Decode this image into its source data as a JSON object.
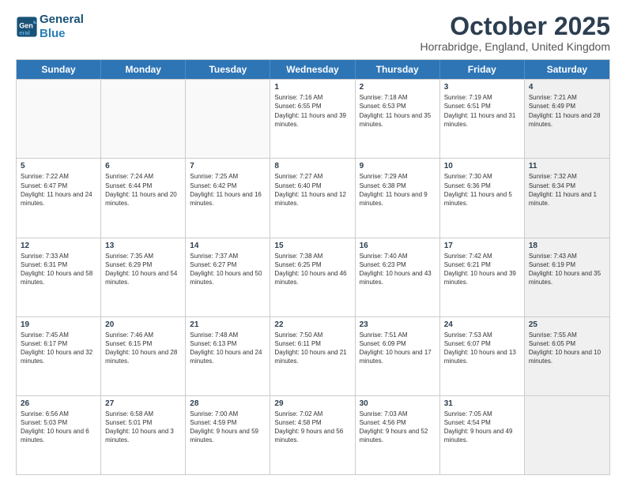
{
  "header": {
    "logo_line1": "General",
    "logo_line2": "Blue",
    "month": "October 2025",
    "location": "Horrabridge, England, United Kingdom"
  },
  "days_of_week": [
    "Sunday",
    "Monday",
    "Tuesday",
    "Wednesday",
    "Thursday",
    "Friday",
    "Saturday"
  ],
  "weeks": [
    [
      {
        "day": "",
        "text": "",
        "empty": true
      },
      {
        "day": "",
        "text": "",
        "empty": true
      },
      {
        "day": "",
        "text": "",
        "empty": true
      },
      {
        "day": "1",
        "text": "Sunrise: 7:16 AM\nSunset: 6:55 PM\nDaylight: 11 hours and 39 minutes."
      },
      {
        "day": "2",
        "text": "Sunrise: 7:18 AM\nSunset: 6:53 PM\nDaylight: 11 hours and 35 minutes."
      },
      {
        "day": "3",
        "text": "Sunrise: 7:19 AM\nSunset: 6:51 PM\nDaylight: 11 hours and 31 minutes."
      },
      {
        "day": "4",
        "text": "Sunrise: 7:21 AM\nSunset: 6:49 PM\nDaylight: 11 hours and 28 minutes.",
        "shaded": true
      }
    ],
    [
      {
        "day": "5",
        "text": "Sunrise: 7:22 AM\nSunset: 6:47 PM\nDaylight: 11 hours and 24 minutes."
      },
      {
        "day": "6",
        "text": "Sunrise: 7:24 AM\nSunset: 6:44 PM\nDaylight: 11 hours and 20 minutes."
      },
      {
        "day": "7",
        "text": "Sunrise: 7:25 AM\nSunset: 6:42 PM\nDaylight: 11 hours and 16 minutes."
      },
      {
        "day": "8",
        "text": "Sunrise: 7:27 AM\nSunset: 6:40 PM\nDaylight: 11 hours and 12 minutes."
      },
      {
        "day": "9",
        "text": "Sunrise: 7:29 AM\nSunset: 6:38 PM\nDaylight: 11 hours and 9 minutes."
      },
      {
        "day": "10",
        "text": "Sunrise: 7:30 AM\nSunset: 6:36 PM\nDaylight: 11 hours and 5 minutes."
      },
      {
        "day": "11",
        "text": "Sunrise: 7:32 AM\nSunset: 6:34 PM\nDaylight: 11 hours and 1 minute.",
        "shaded": true
      }
    ],
    [
      {
        "day": "12",
        "text": "Sunrise: 7:33 AM\nSunset: 6:31 PM\nDaylight: 10 hours and 58 minutes."
      },
      {
        "day": "13",
        "text": "Sunrise: 7:35 AM\nSunset: 6:29 PM\nDaylight: 10 hours and 54 minutes."
      },
      {
        "day": "14",
        "text": "Sunrise: 7:37 AM\nSunset: 6:27 PM\nDaylight: 10 hours and 50 minutes."
      },
      {
        "day": "15",
        "text": "Sunrise: 7:38 AM\nSunset: 6:25 PM\nDaylight: 10 hours and 46 minutes."
      },
      {
        "day": "16",
        "text": "Sunrise: 7:40 AM\nSunset: 6:23 PM\nDaylight: 10 hours and 43 minutes."
      },
      {
        "day": "17",
        "text": "Sunrise: 7:42 AM\nSunset: 6:21 PM\nDaylight: 10 hours and 39 minutes."
      },
      {
        "day": "18",
        "text": "Sunrise: 7:43 AM\nSunset: 6:19 PM\nDaylight: 10 hours and 35 minutes.",
        "shaded": true
      }
    ],
    [
      {
        "day": "19",
        "text": "Sunrise: 7:45 AM\nSunset: 6:17 PM\nDaylight: 10 hours and 32 minutes."
      },
      {
        "day": "20",
        "text": "Sunrise: 7:46 AM\nSunset: 6:15 PM\nDaylight: 10 hours and 28 minutes."
      },
      {
        "day": "21",
        "text": "Sunrise: 7:48 AM\nSunset: 6:13 PM\nDaylight: 10 hours and 24 minutes."
      },
      {
        "day": "22",
        "text": "Sunrise: 7:50 AM\nSunset: 6:11 PM\nDaylight: 10 hours and 21 minutes."
      },
      {
        "day": "23",
        "text": "Sunrise: 7:51 AM\nSunset: 6:09 PM\nDaylight: 10 hours and 17 minutes."
      },
      {
        "day": "24",
        "text": "Sunrise: 7:53 AM\nSunset: 6:07 PM\nDaylight: 10 hours and 13 minutes."
      },
      {
        "day": "25",
        "text": "Sunrise: 7:55 AM\nSunset: 6:05 PM\nDaylight: 10 hours and 10 minutes.",
        "shaded": true
      }
    ],
    [
      {
        "day": "26",
        "text": "Sunrise: 6:56 AM\nSunset: 5:03 PM\nDaylight: 10 hours and 6 minutes."
      },
      {
        "day": "27",
        "text": "Sunrise: 6:58 AM\nSunset: 5:01 PM\nDaylight: 10 hours and 3 minutes."
      },
      {
        "day": "28",
        "text": "Sunrise: 7:00 AM\nSunset: 4:59 PM\nDaylight: 9 hours and 59 minutes."
      },
      {
        "day": "29",
        "text": "Sunrise: 7:02 AM\nSunset: 4:58 PM\nDaylight: 9 hours and 56 minutes."
      },
      {
        "day": "30",
        "text": "Sunrise: 7:03 AM\nSunset: 4:56 PM\nDaylight: 9 hours and 52 minutes."
      },
      {
        "day": "31",
        "text": "Sunrise: 7:05 AM\nSunset: 4:54 PM\nDaylight: 9 hours and 49 minutes."
      },
      {
        "day": "",
        "text": "",
        "empty": true,
        "shaded": true
      }
    ]
  ]
}
